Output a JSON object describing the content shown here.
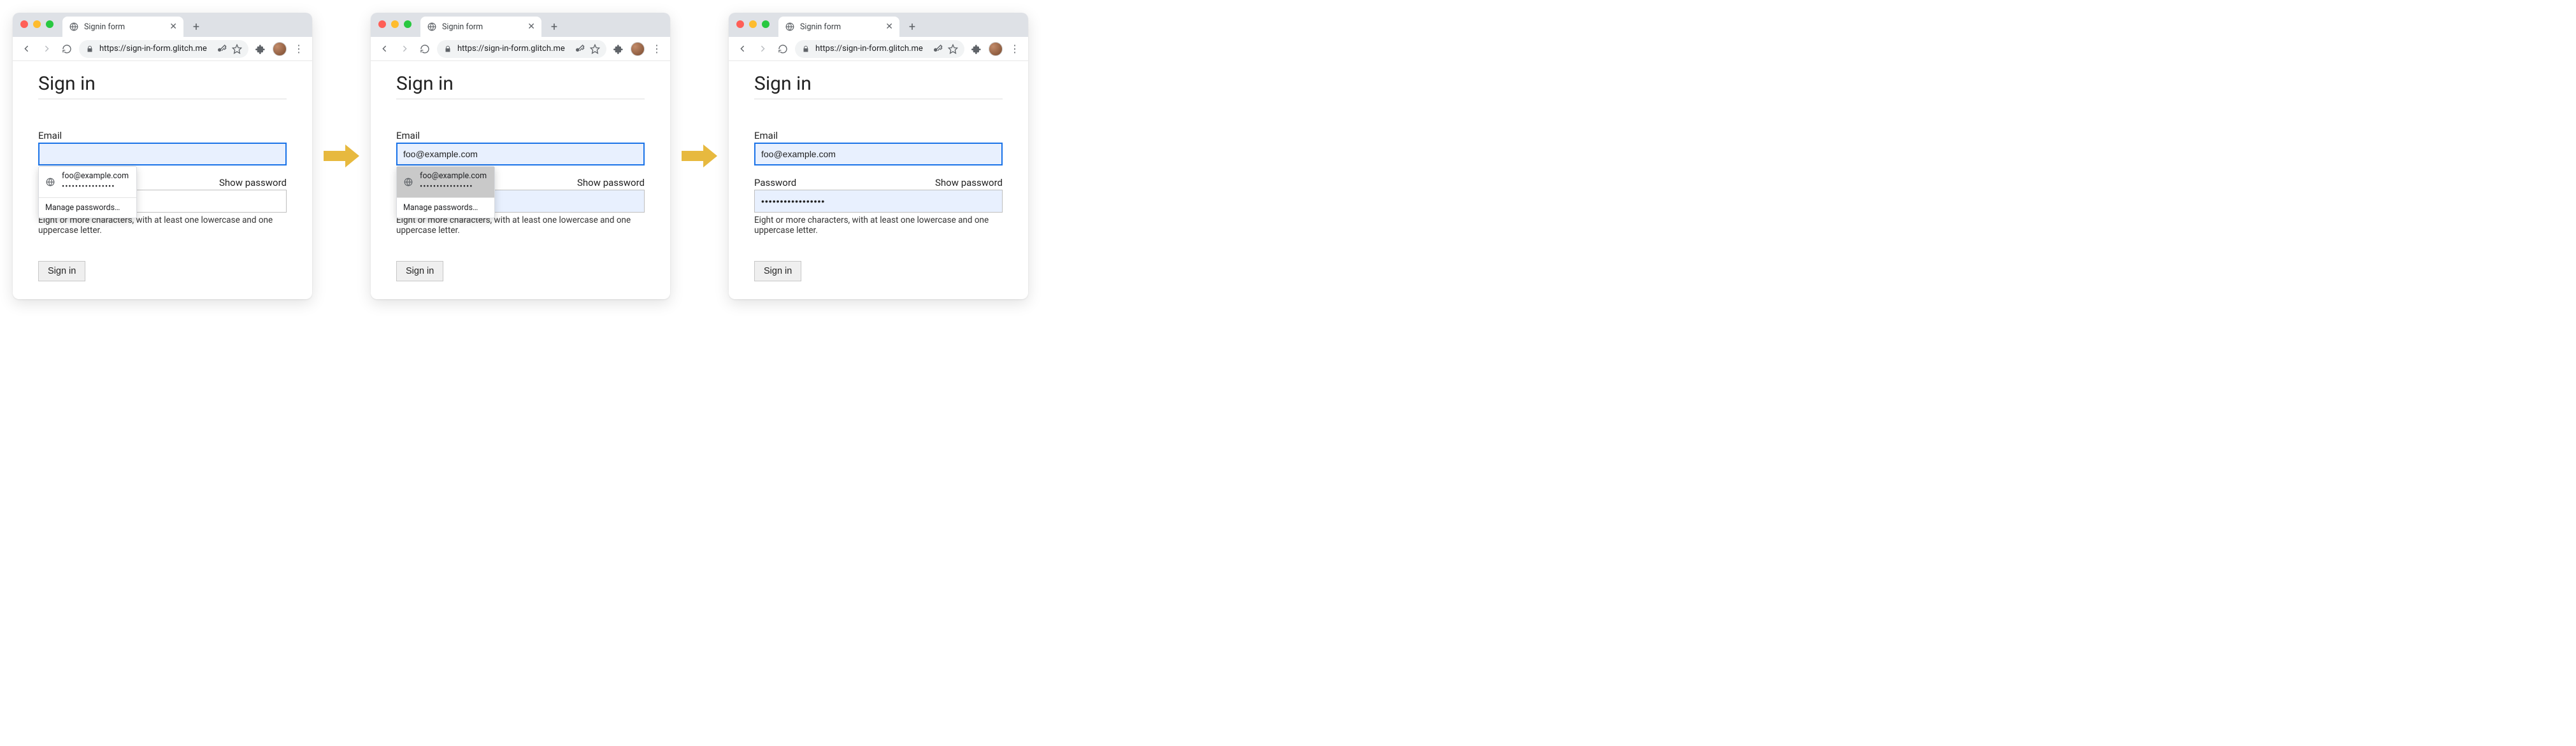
{
  "chrome": {
    "tab_title": "Signin form",
    "url": "https://sign-in-form.glitch.me",
    "close_glyph": "✕",
    "newtab_glyph": "+",
    "menu_glyph": "⋮"
  },
  "page": {
    "heading": "Sign in",
    "email_label": "Email",
    "password_label": "Password",
    "show_password": "Show password",
    "hint": "Eight or more characters, with at least one lowercase and one uppercase letter.",
    "signin_button": "Sign in"
  },
  "autofill": {
    "suggestion_email": "foo@example.com",
    "suggestion_password_mask": "••••••••••••••••",
    "manage": "Manage passwords…"
  },
  "state2": {
    "email_value": "foo@example.com"
  },
  "state3": {
    "email_value": "foo@example.com",
    "password_mask": "•••••••••••••••••"
  }
}
